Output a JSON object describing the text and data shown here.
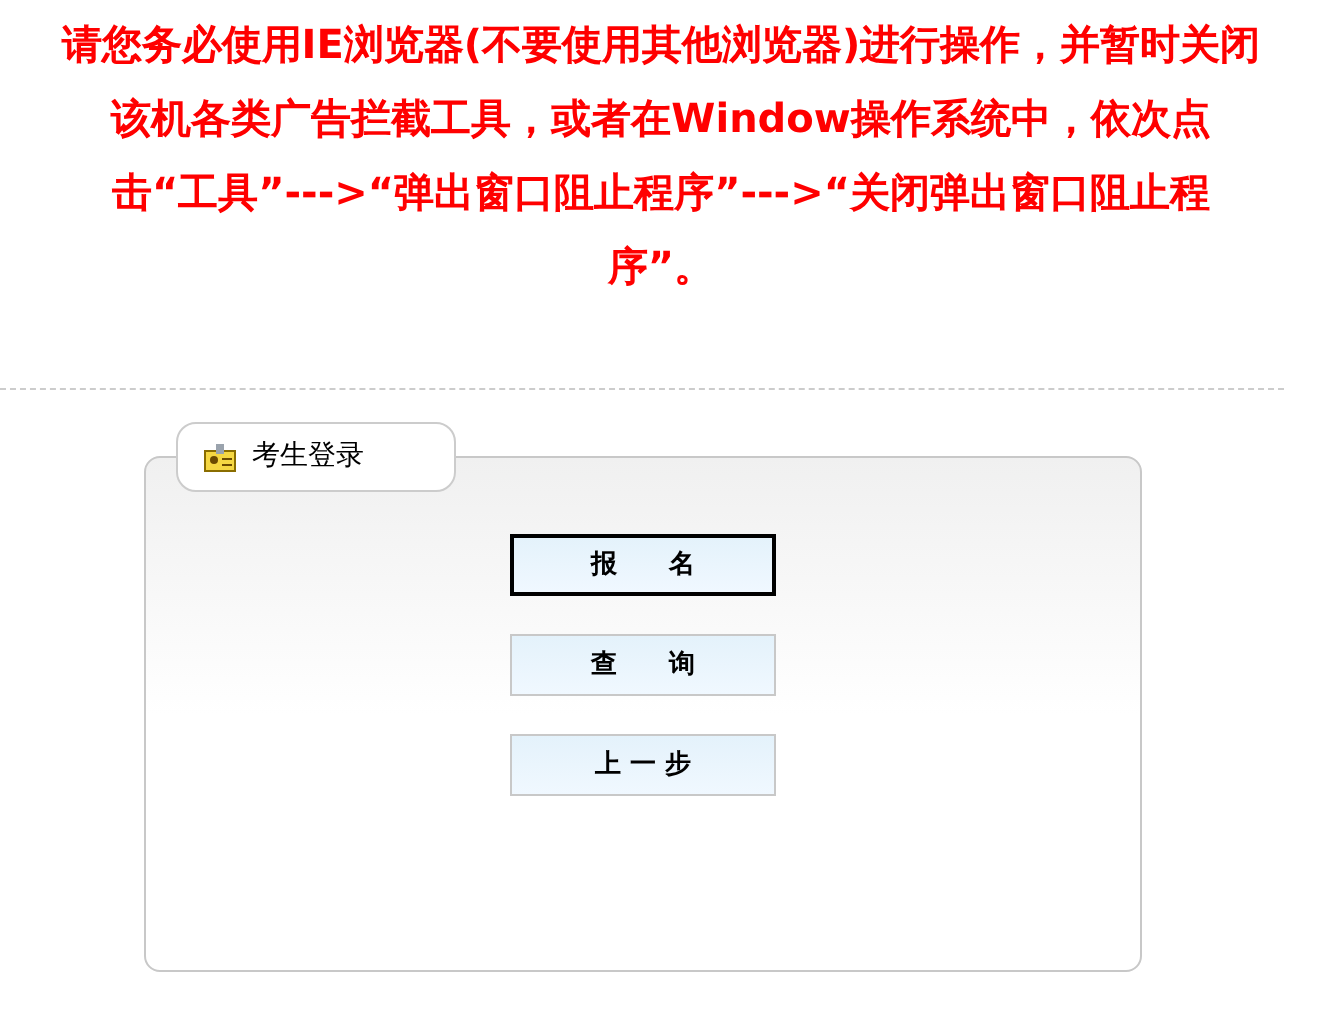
{
  "notice": "请您务必使用IE浏览器(不要使用其他浏览器)进行操作，并暂时关闭该机各类广告拦截工具，或者在Window操作系统中，依次点击“工具”--->“弹出窗口阻止程序”--->“关闭弹出窗口阻止程序”。",
  "panel": {
    "title": "考生登录",
    "buttons": [
      {
        "label": "报　　名",
        "selected": true
      },
      {
        "label": "查　　询",
        "selected": false
      },
      {
        "label": "上 一 步",
        "selected": false
      }
    ]
  }
}
